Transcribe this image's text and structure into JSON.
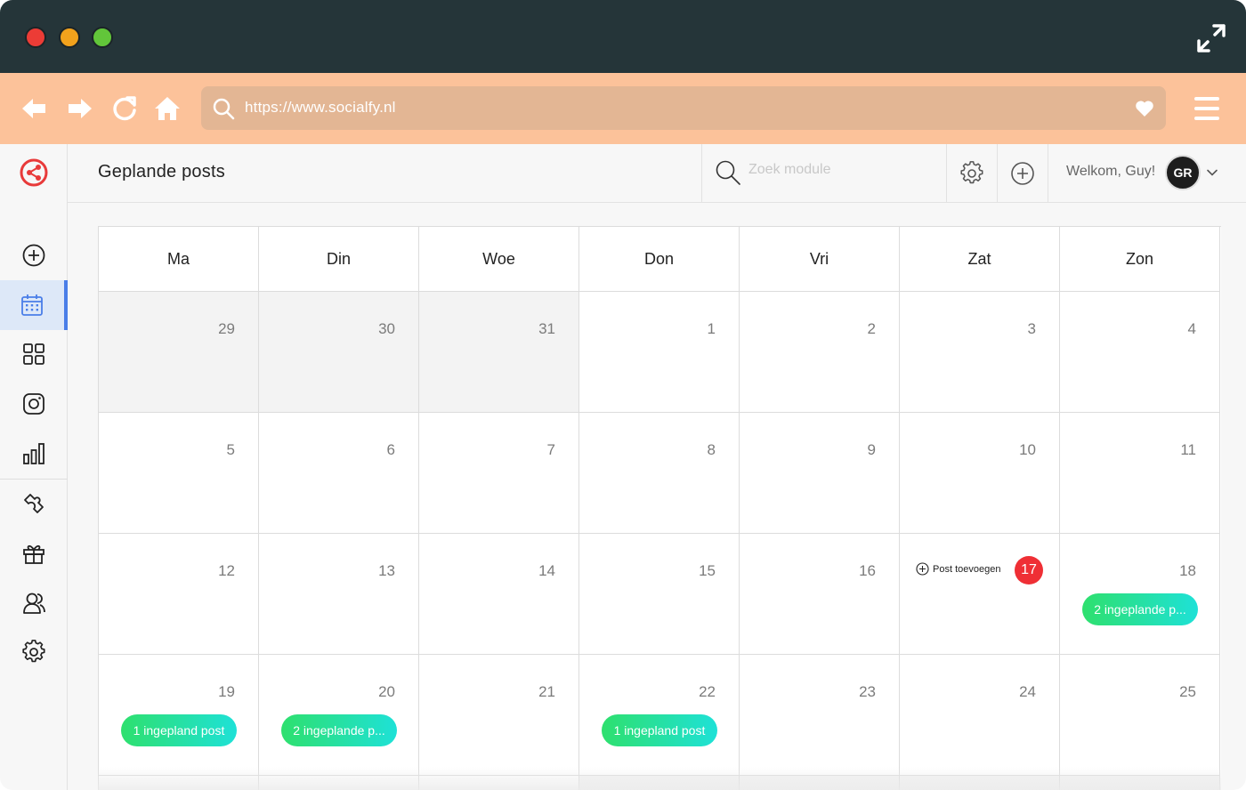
{
  "browser": {
    "url": "https://www.socialfy.nl"
  },
  "header": {
    "title": "Geplande posts",
    "search_placeholder": "Zoek module",
    "welcome": "Welkom, Guy!",
    "avatar_initials": "GR"
  },
  "calendar": {
    "weekdays": [
      "Ma",
      "Din",
      "Woe",
      "Don",
      "Vri",
      "Zat",
      "Zon"
    ],
    "weeks": [
      [
        "29",
        "30",
        "31",
        "1",
        "2",
        "3",
        "4"
      ],
      [
        "5",
        "6",
        "7",
        "8",
        "9",
        "10",
        "11"
      ],
      [
        "12",
        "13",
        "14",
        "15",
        "16",
        "17",
        "18"
      ],
      [
        "19",
        "20",
        "21",
        "22",
        "23",
        "24",
        "25"
      ]
    ],
    "today": "17",
    "add_post_label": "Post toevoegen",
    "events": {
      "d18": "2 ingeplande p...",
      "d19": "1 ingepland post",
      "d20": "2 ingeplande p...",
      "d22": "1 ingepland post"
    }
  },
  "colors": {
    "titlebar": "#253539",
    "browserbar": "#fcc29a",
    "accent_red": "#ef2f35",
    "active_nav": "#4a7ee8",
    "pill_start": "#2ee06e",
    "pill_end": "#1ee1d7"
  },
  "icons": {
    "sidebar": [
      "plus-circle-icon",
      "calendar-icon",
      "grid-icon",
      "instagram-icon",
      "bar-chart-icon",
      "puzzle-icon",
      "gift-icon",
      "users-icon",
      "gear-icon"
    ]
  }
}
